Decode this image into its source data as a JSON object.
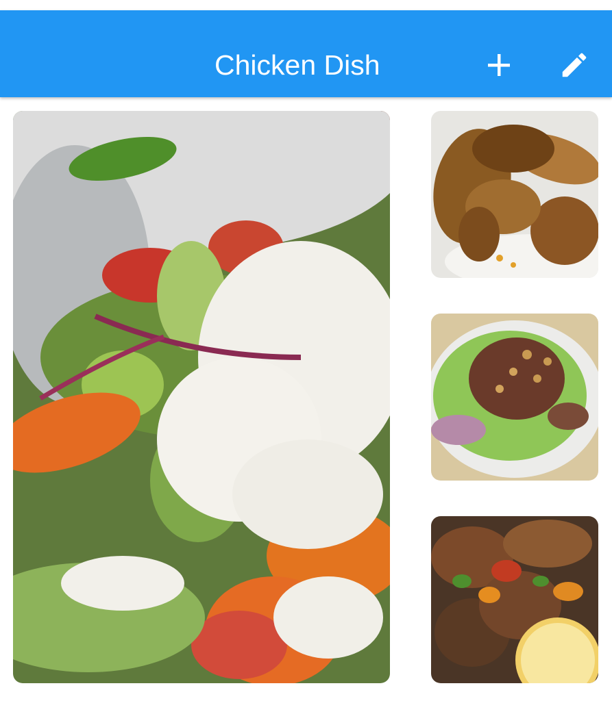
{
  "app_bar": {
    "title": "Chicken Dish",
    "background_color": "#2196F3",
    "actions": [
      {
        "icon": "plus-icon"
      },
      {
        "icon": "pencil-icon"
      }
    ]
  },
  "gallery": {
    "main_photo": {
      "subject": "salad-with-feta-cucumber-tomato-photo"
    },
    "thumbnails": [
      {
        "subject": "grilled-chicken-wings-photo"
      },
      {
        "subject": "salad-with-onions-and-peanuts-photo"
      },
      {
        "subject": "grilled-chicken-with-vegetables-and-lemon-photo"
      }
    ]
  }
}
